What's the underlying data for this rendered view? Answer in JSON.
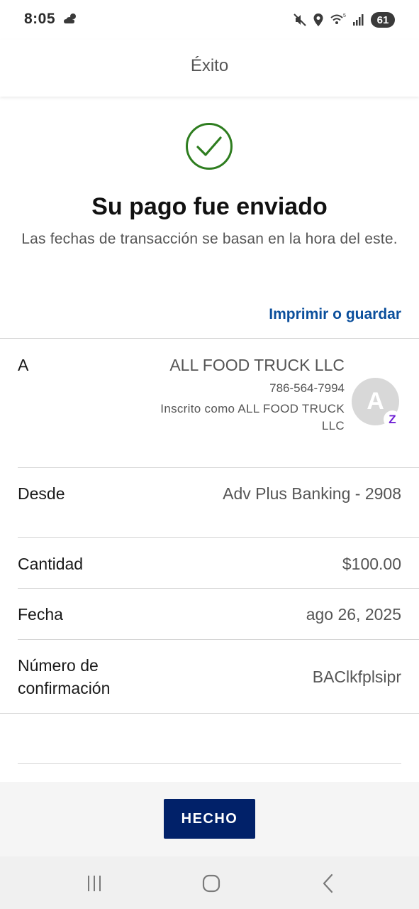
{
  "status_bar": {
    "time": "8:05",
    "battery": "61"
  },
  "header": {
    "title": "Éxito"
  },
  "confirmation": {
    "title": "Su pago fue enviado",
    "note": "Las fechas de transacción se basan en la hora del este.",
    "print_link": "Imprimir o guardar"
  },
  "details": {
    "to": {
      "label": "A",
      "name": "ALL FOOD TRUCK LLC",
      "phone": "786-564-7994",
      "enrolled": "Inscrito como ALL FOOD TRUCK LLC",
      "avatar_letter": "A",
      "badge": "Z"
    },
    "from": {
      "label": "Desde",
      "value": "Adv Plus Banking - 2908"
    },
    "amount": {
      "label": "Cantidad",
      "value": "$100.00"
    },
    "date": {
      "label": "Fecha",
      "value": "ago 26, 2025"
    },
    "confirmation_number": {
      "label": "Número de confirmación",
      "value": "BAClkfplsipr"
    }
  },
  "footer": {
    "done_label": "HECHO"
  },
  "colors": {
    "accent_link": "#0b4f9c",
    "button_bg": "#012169",
    "success_green": "#2e7d1f",
    "zelle_purple": "#6d1ed4"
  },
  "icons": {
    "weather": "cloud-sun-icon",
    "mute": "mute-icon",
    "location": "location-icon",
    "wifi": "wifi-icon",
    "signal": "signal-icon",
    "success": "checkmark-circle-icon",
    "nav_recents": "recents-icon",
    "nav_home": "home-icon",
    "nav_back": "back-icon"
  }
}
